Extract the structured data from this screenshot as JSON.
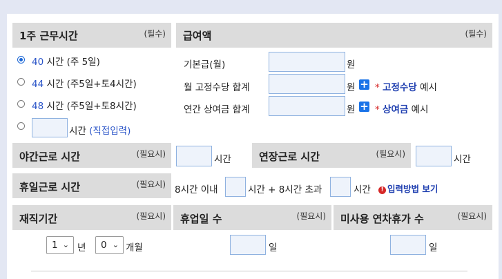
{
  "weekly_hours": {
    "title": "1주 근무시간",
    "note": "(필수)",
    "options": [
      {
        "num": "40",
        "label": "시간 (주 5일)",
        "selected": true
      },
      {
        "num": "44",
        "label": "시간 (주5일+토4시간)",
        "selected": false
      },
      {
        "num": "48",
        "label": "시간 (주5일+토8시간)",
        "selected": false
      }
    ],
    "custom_unit": "시간",
    "custom_label": "(직접입력)"
  },
  "salary": {
    "title": "급여액",
    "note": "(필수)",
    "base_label": "기본급(월)",
    "fixed_allowance_label": "월 고정수당 합계",
    "bonus_label": "연간 상여금 합계",
    "won": "원",
    "asterisk": "*",
    "allowance_link": "고정수당",
    "bonus_link": "상여금",
    "example": "예시",
    "plus": "+"
  },
  "night_work": {
    "title": "야간근로 시간",
    "note": "(필요시)",
    "unit": "시간"
  },
  "overtime": {
    "title": "연장근로 시간",
    "note": "(필요시)",
    "unit": "시간"
  },
  "holiday_work": {
    "title": "휴일근로 시간",
    "note": "(필요시)",
    "within_label": "8시간 이내",
    "plus_label": "시간 + 8시간 초과",
    "unit": "시간",
    "help_link": "입력방법 보기",
    "info_icon": "!"
  },
  "tenure": {
    "title": "재직기간",
    "note": "(필요시)",
    "years_value": "1",
    "years_unit": "년",
    "months_value": "0",
    "months_unit": "개월",
    "chevron": "⌄"
  },
  "leave_days": {
    "title": "휴업일 수",
    "note": "(필요시)",
    "unit": "일"
  },
  "unused_leave": {
    "title": "미사용 연차휴가 수",
    "note": "(필요시)",
    "unit": "일"
  }
}
